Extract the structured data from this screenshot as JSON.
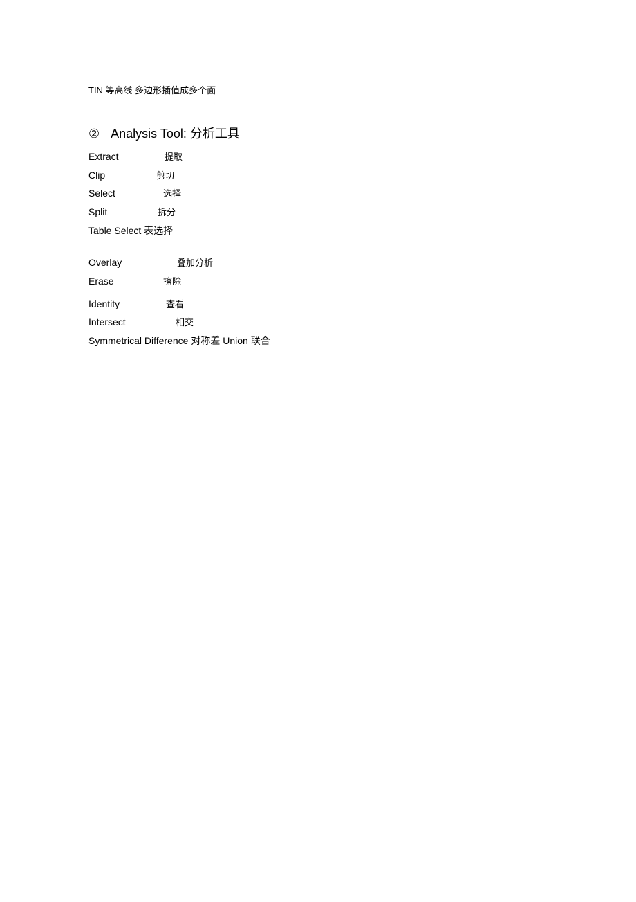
{
  "top_line": "TIN 等高线 多边形插值成多个面",
  "heading": {
    "num": "②",
    "text_en": "Analysis Tool:",
    "text_zh": "分析工具"
  },
  "group1": [
    {
      "en": "Extract",
      "en_w": 110,
      "zh": "提取"
    },
    {
      "en": "Clip",
      "en_w": 98,
      "zh": "剪切"
    },
    {
      "en": "Select",
      "en_w": 108,
      "zh": "选择"
    },
    {
      "en": "Split",
      "en_w": 100,
      "zh": "拆分"
    }
  ],
  "group1_last": "Table Select 表选择",
  "group2": [
    {
      "en": "Overlay",
      "en_w": 128,
      "zh": "叠加分析"
    },
    {
      "en": "Erase",
      "en_w": 108,
      "zh": "擦除"
    }
  ],
  "group3": [
    {
      "en": "Identity",
      "en_w": 112,
      "zh": "查看"
    },
    {
      "en": "Intersect",
      "en_w": 126,
      "zh": "相交"
    }
  ],
  "last_line": "Symmetrical Difference 对称差  Union 联合"
}
